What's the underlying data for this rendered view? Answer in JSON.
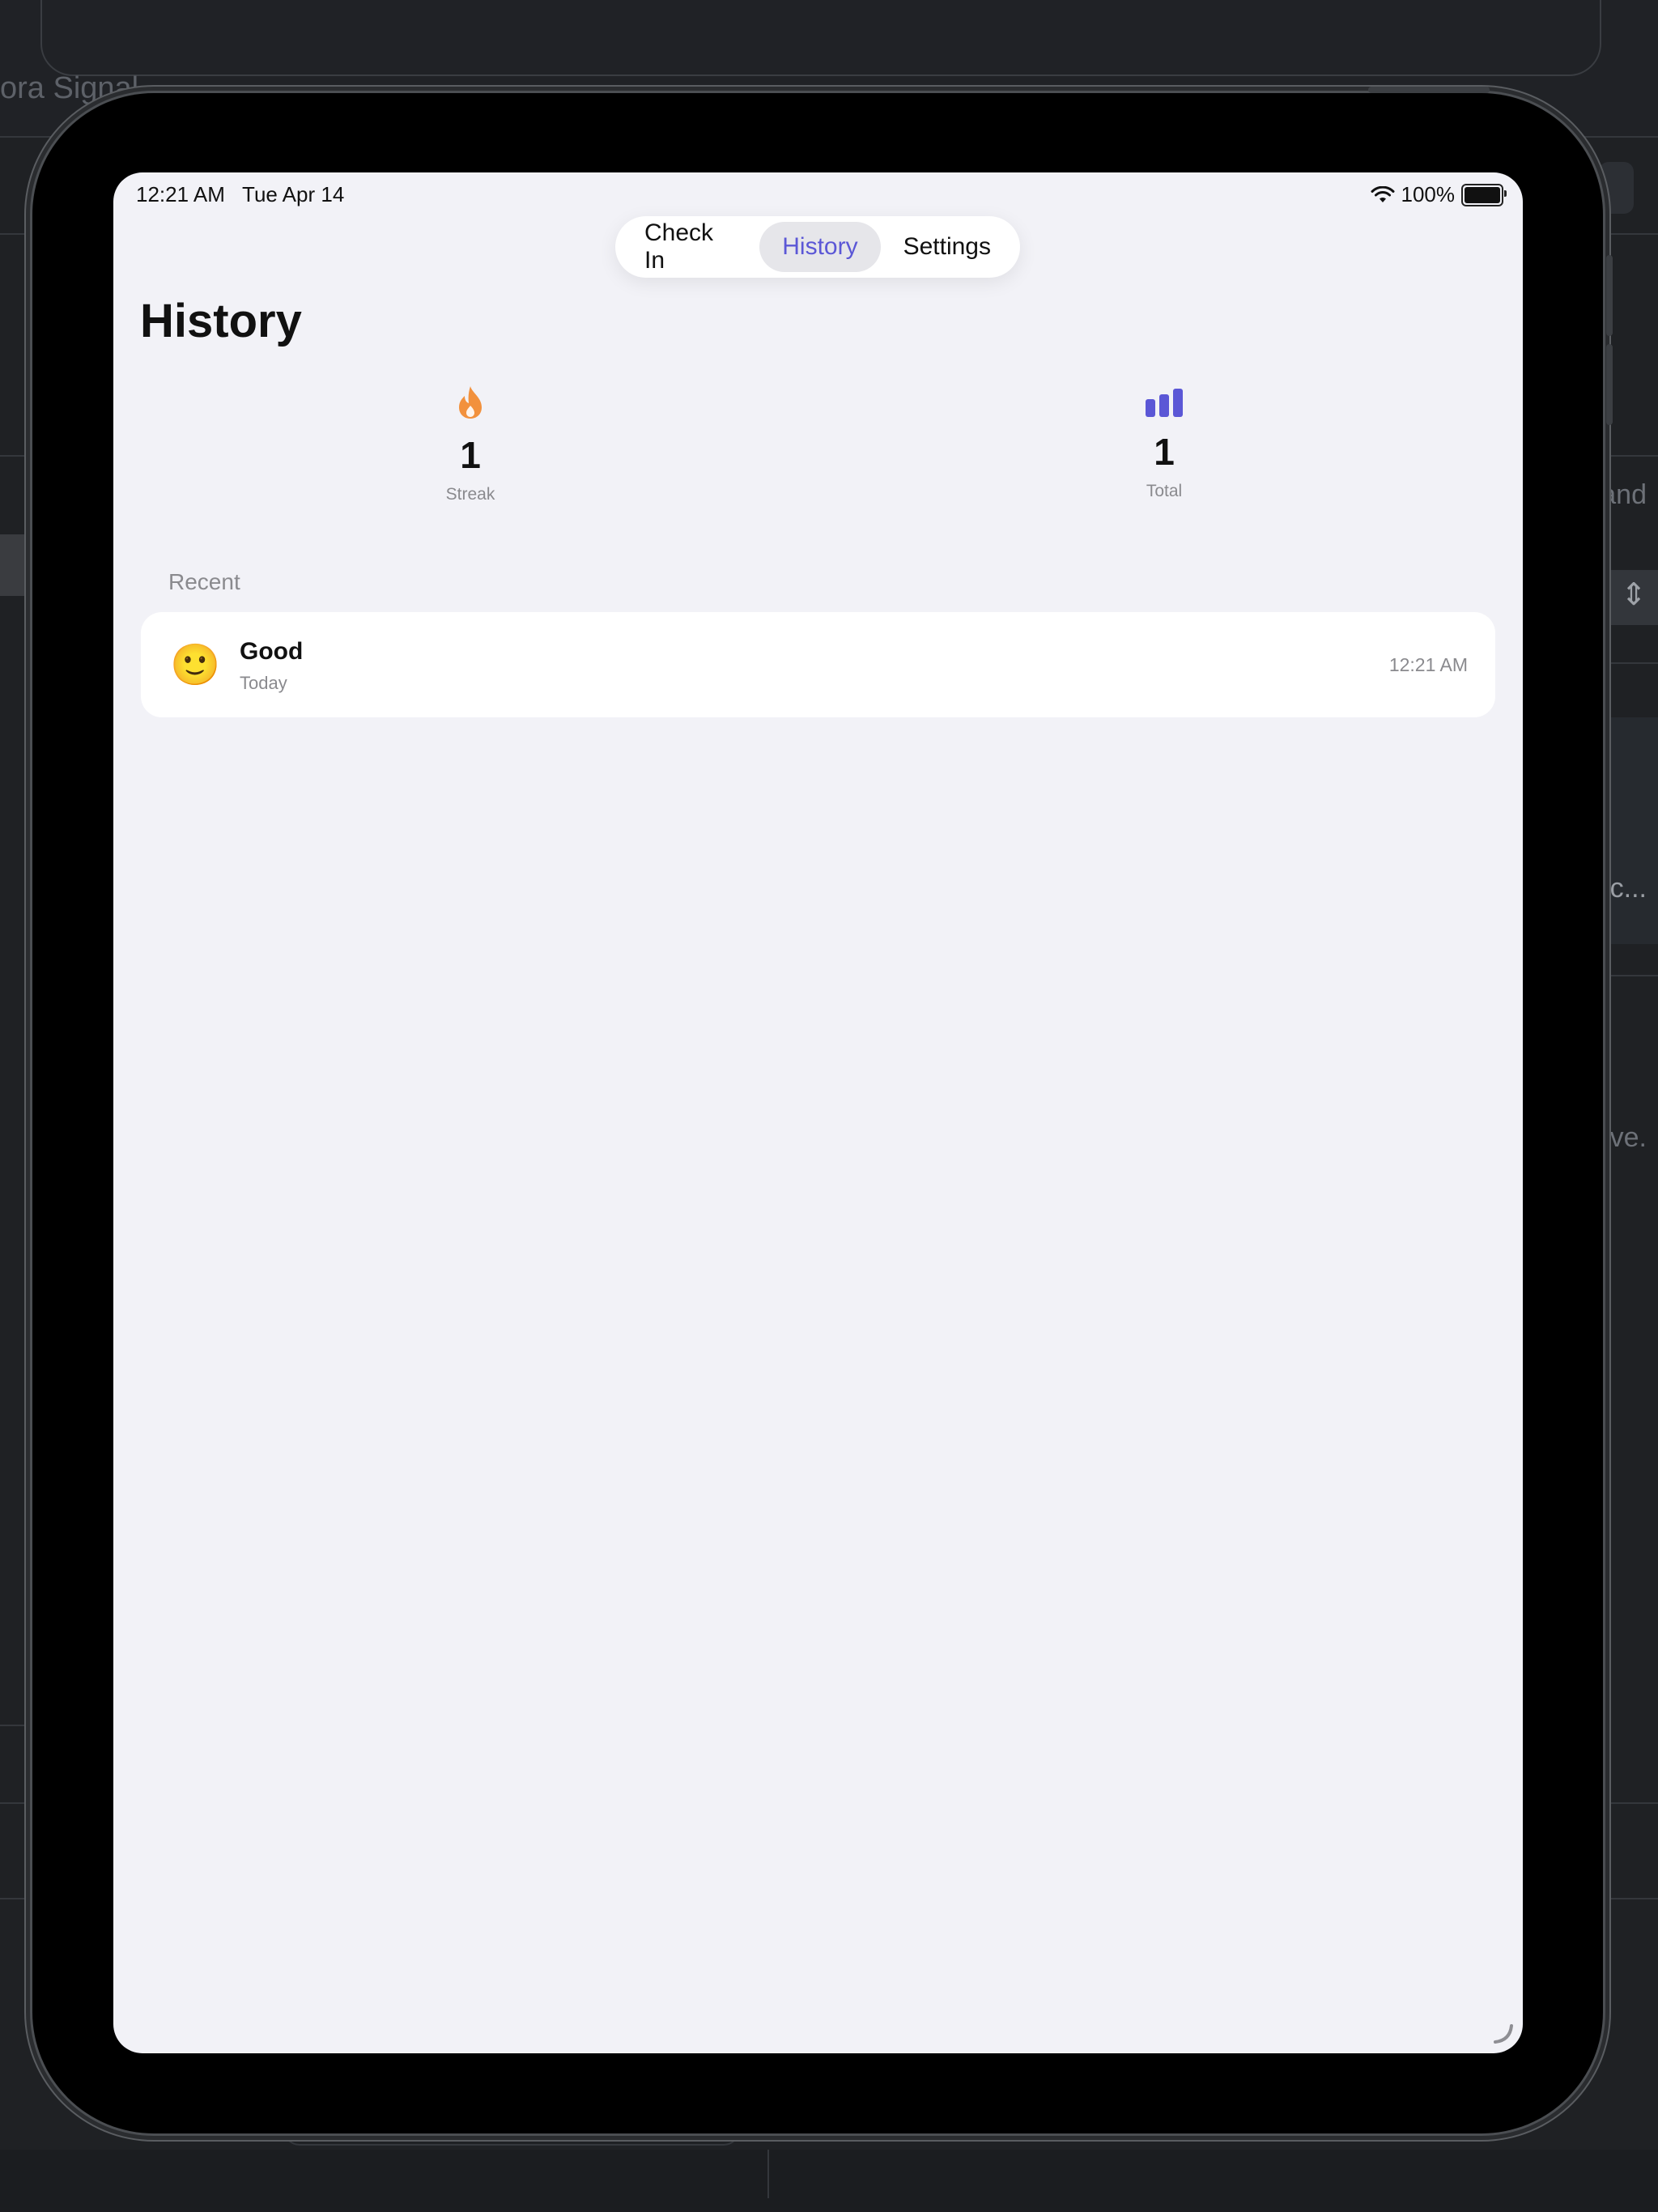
{
  "background": {
    "left_title": "ora Signal",
    "right_texts": [
      "and",
      ".c...",
      "ove."
    ]
  },
  "status_bar": {
    "time": "12:21 AM   Tue Apr 14",
    "battery": "100%"
  },
  "tabs": [
    {
      "label": "Check In",
      "selected": false
    },
    {
      "label": "History",
      "selected": true
    },
    {
      "label": "Settings",
      "selected": false
    }
  ],
  "page": {
    "title": "History"
  },
  "stats": {
    "streak": {
      "value": "1",
      "label": "Streak",
      "icon": "flame-icon"
    },
    "total": {
      "value": "1",
      "label": "Total",
      "icon": "bar-chart-icon"
    }
  },
  "recent": {
    "header": "Recent",
    "entries": [
      {
        "emoji": "🙂",
        "mood": "Good",
        "date": "Today",
        "time": "12:21 AM"
      }
    ]
  },
  "colors": {
    "accent": "#5b57d6",
    "streak": "#f2913d",
    "background": "#f2f2f7"
  }
}
